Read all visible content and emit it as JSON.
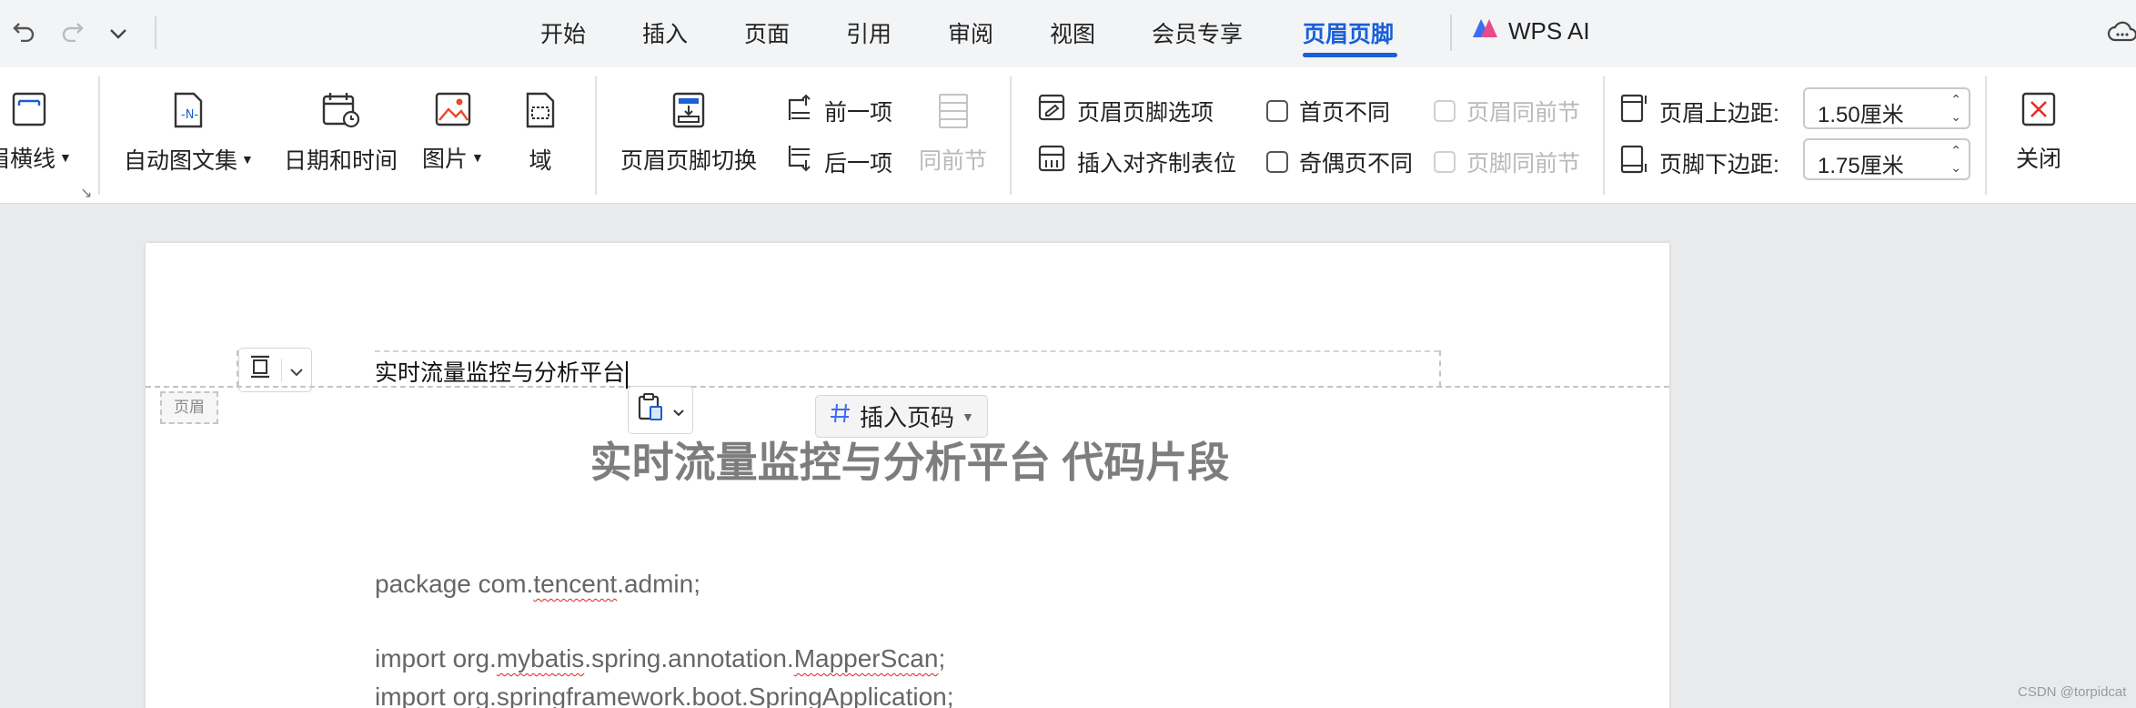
{
  "quick_access": {
    "undo": "undo-icon",
    "redo": "redo-icon",
    "more": "chevron-down-icon"
  },
  "tabs": [
    "开始",
    "插入",
    "页面",
    "引用",
    "审阅",
    "视图",
    "会员专享",
    "页眉页脚"
  ],
  "active_tab": "页眉页脚",
  "wps_ai": "WPS AI",
  "ribbon": {
    "header_line": "眉横线",
    "auto_text": "自动图文集",
    "date_time": "日期和时间",
    "picture": "图片",
    "field": "域",
    "switch": "页眉页脚切换",
    "prev": "前一项",
    "next": "后一项",
    "same_as_prev": "同前节",
    "options": "页眉页脚选项",
    "insert_align_tab": "插入对齐制表位",
    "first_page_diff": "首页不同",
    "odd_even_diff": "奇偶页不同",
    "header_same_prev": "页眉同前节",
    "footer_same_prev": "页脚同前节",
    "header_top_label": "页眉上边距:",
    "header_top_value": "1.50厘米",
    "footer_bottom_label": "页脚下边距:",
    "footer_bottom_value": "1.75厘米",
    "close": "关闭"
  },
  "document": {
    "header_text": "实时流量监控与分析平台",
    "header_tag": "页眉",
    "insert_page_number": "插入页码",
    "title": "实时流量监控与分析平台  代码片段",
    "code": {
      "line1_a": "package com.",
      "line1_b": "tencent",
      "line1_c": ".admin;",
      "line2_a": "import org.",
      "line2_b": "mybatis",
      "line2_c": ".spring.annotation.",
      "line2_d": "MapperScan",
      "line2_e": ";",
      "line3": "import org.springframework.boot.SpringApplication;"
    }
  },
  "watermark": "CSDN @torpidcat",
  "colors": {
    "accent": "#1a5fd6",
    "close_red": "#e0302b",
    "squiggle": "#e02020"
  }
}
